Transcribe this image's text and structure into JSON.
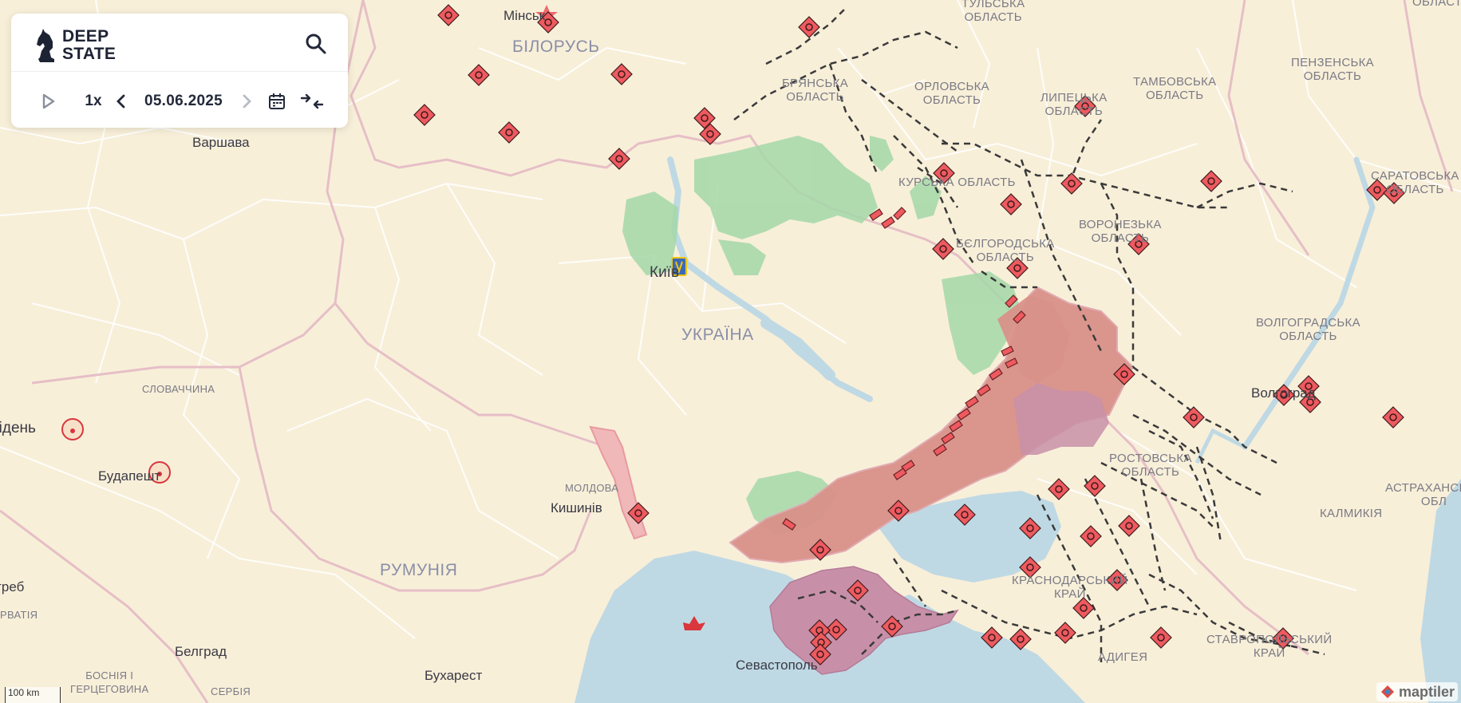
{
  "app": {
    "brand_line1": "DEEP",
    "brand_line2": "STATE",
    "speed": "1x",
    "date": "05.06.2025",
    "icons": [
      "search-icon",
      "play-icon",
      "chevron-left-icon",
      "chevron-right-icon",
      "calendar-icon",
      "collapse-icon"
    ]
  },
  "map": {
    "scale_label": "100 km",
    "attribution": "maptiler",
    "labels": {
      "tula": "ТУЛЬСЬКА\nОБЛАСТЬ",
      "bryansk": "БРЯНСЬКА\nОБЛАСТЬ",
      "orel": "ОРЛОВСЬКА\nОБЛАСТЬ",
      "lipetsk": "ЛИПЕЦЬКА\nОБЛАСТЬ",
      "tambov": "ТАМБОВСЬКА\nОБЛАСТЬ",
      "penza": "ПЕНЗЕНСЬКА\nОБЛАСТЬ",
      "kursk": "КУРСЬКА ОБЛАСТЬ",
      "voronezh": "ВОРОНЕЗЬКА\nОБЛАСТЬ",
      "belgorod": "БЄЛГОРОДСЬКА\nОБЛАСТЬ",
      "saratov": "САРАТОВСЬКА\nОБЛАСТЬ",
      "volgograd": "ВОЛГОГРАДСЬКА\nОБЛАСТЬ",
      "rostov": "РОСТОВСЬКА\nОБЛАСТЬ",
      "kalmykia": "КАЛМИКІЯ",
      "astrakhan": "АСТРАХАНСЬКА\nОБЛ",
      "krasnodar": "КРАСНОДАРСЬКИЙ\nКРАЙ",
      "stavropol": "СТАВРОПОЛЬСЬКИЙ\nКРАЙ",
      "adygea": "АДИГЕЯ",
      "belarus": "БІЛОРУСЬ",
      "ukraine": "УКРАЇНА",
      "moldova": "МОЛДОВА",
      "romania": "РУМУНІЯ",
      "slovakia": "СЛОВАЧЧИНА",
      "croatia": "РВАТІЯ",
      "bosnia": "БОСНІЯ І\nГЕРЦЕГОВИНА",
      "serbia": "СЕРБІЯ",
      "minsk": "Мінськ",
      "warsaw": "Варшава",
      "kyiv": "Київ",
      "chisinau": "Кишинів",
      "budapest": "Будапешт",
      "vienna": "Відень",
      "zagreb": "Загреб",
      "belgrade": "Белград",
      "bucharest": "Бухарест",
      "sevastopol": "Севастополь",
      "volgograd_city": "Волгоград",
      "top_right": "ОБЛАСТЬ"
    },
    "colors": {
      "land": "#f8efd9",
      "sea": "#bfd9e4",
      "occupied": "#d99189",
      "occupied_border": "#e0a8b0",
      "crimea": "#c890a8",
      "liberated": "#a4d8a8",
      "marker": "#ee5a5f",
      "border": "#e6bfc6",
      "internal_border": "#ffffff"
    }
  }
}
